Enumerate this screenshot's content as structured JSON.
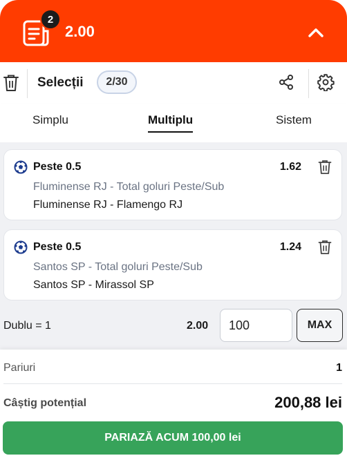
{
  "header": {
    "selection_count": "2",
    "total_odds": "2.00",
    "bg_color": "#ff3c00"
  },
  "toolbar": {
    "title": "Selecții",
    "count": "2/30",
    "icons": [
      "trash-icon",
      "share-icon",
      "settings-icon"
    ]
  },
  "tabs": [
    {
      "label": "Simplu",
      "active": false
    },
    {
      "label": "Multiplu",
      "active": true
    },
    {
      "label": "Sistem",
      "active": false
    }
  ],
  "selections": [
    {
      "selection": "Peste 0.5",
      "odds": "1.62",
      "market": "Fluminense RJ - Total goluri Peste/Sub",
      "match": "Fluminense RJ - Flamengo RJ"
    },
    {
      "selection": "Peste 0.5",
      "odds": "1.24",
      "market": "Santos SP - Total goluri Peste/Sub",
      "match": "Santos SP - Mirassol SP"
    }
  ],
  "stake_row": {
    "label": "Dublu = 1",
    "odds": "2.00",
    "stake_value": "100",
    "max_label": "MAX"
  },
  "summary": {
    "bets_label": "Pariuri",
    "bets_value": "1",
    "win_label": "Câștig potențial",
    "win_value": "200,88 lei",
    "place_bet_label": "PARIAZĂ ACUM 100,00 lei",
    "button_color": "#37a35a"
  }
}
